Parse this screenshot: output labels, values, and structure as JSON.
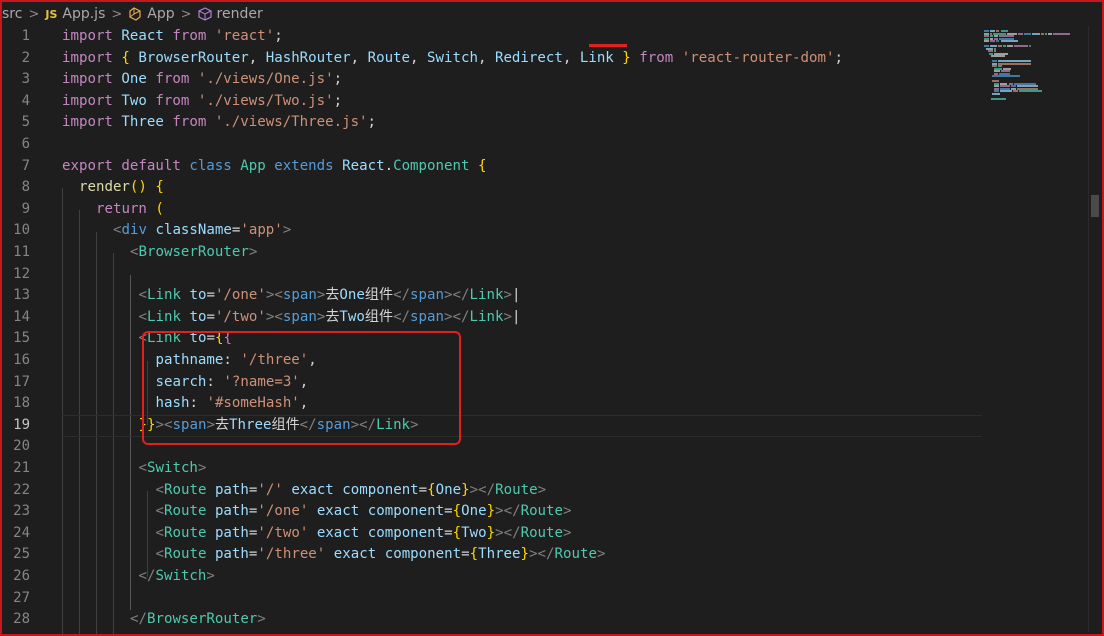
{
  "breadcrumb": {
    "folder": "src",
    "file_badge": "JS",
    "file": "App.js",
    "class_symbol": "App",
    "method_symbol": "render",
    "class_icon": "symbol-class-icon",
    "method_icon": "symbol-method-icon"
  },
  "editor": {
    "language": "javascript",
    "active_line": 19,
    "lines": [
      {
        "n": "1",
        "text": "import React from 'react';"
      },
      {
        "n": "2",
        "text": "import { BrowserRouter, HashRouter, Route, Switch, Redirect, Link } from 'react-router-dom';"
      },
      {
        "n": "3",
        "text": "import One from './views/One.js';"
      },
      {
        "n": "4",
        "text": "import Two from './views/Two.js';"
      },
      {
        "n": "5",
        "text": "import Three from './views/Three.js';"
      },
      {
        "n": "6",
        "text": ""
      },
      {
        "n": "7",
        "text": "export default class App extends React.Component {"
      },
      {
        "n": "8",
        "text": "  render() {"
      },
      {
        "n": "9",
        "text": "    return ("
      },
      {
        "n": "10",
        "text": "      <div className='app'>"
      },
      {
        "n": "11",
        "text": "        <BrowserRouter>"
      },
      {
        "n": "12",
        "text": ""
      },
      {
        "n": "13",
        "text": "         <Link to='/one'><span>去One组件</span></Link>|"
      },
      {
        "n": "14",
        "text": "         <Link to='/two'><span>去Two组件</span></Link>|"
      },
      {
        "n": "15",
        "text": "         <Link to={{"
      },
      {
        "n": "16",
        "text": "           pathname: '/three',"
      },
      {
        "n": "17",
        "text": "           search: '?name=3',"
      },
      {
        "n": "18",
        "text": "           hash: '#someHash',"
      },
      {
        "n": "19",
        "text": "         }}><span>去Three组件</span></Link>"
      },
      {
        "n": "20",
        "text": ""
      },
      {
        "n": "21",
        "text": "         <Switch>"
      },
      {
        "n": "22",
        "text": "           <Route path='/' exact component={One}></Route>"
      },
      {
        "n": "23",
        "text": "           <Route path='/one' exact component={One}></Route>"
      },
      {
        "n": "24",
        "text": "           <Route path='/two' exact component={Two}></Route>"
      },
      {
        "n": "25",
        "text": "           <Route path='/three' exact component={Three}></Route>"
      },
      {
        "n": "26",
        "text": "         </Switch>"
      },
      {
        "n": "27",
        "text": ""
      },
      {
        "n": "28",
        "text": "        </BrowserRouter>"
      }
    ]
  },
  "annotations": {
    "underline_color": "#e0211f",
    "box_color": "#e0211f"
  },
  "theme": {
    "background": "#1e1e1e",
    "keyword": "#569cd6",
    "control": "#c586c0",
    "variable": "#9cdcfe",
    "class": "#4ec9b0",
    "string": "#ce9178"
  }
}
